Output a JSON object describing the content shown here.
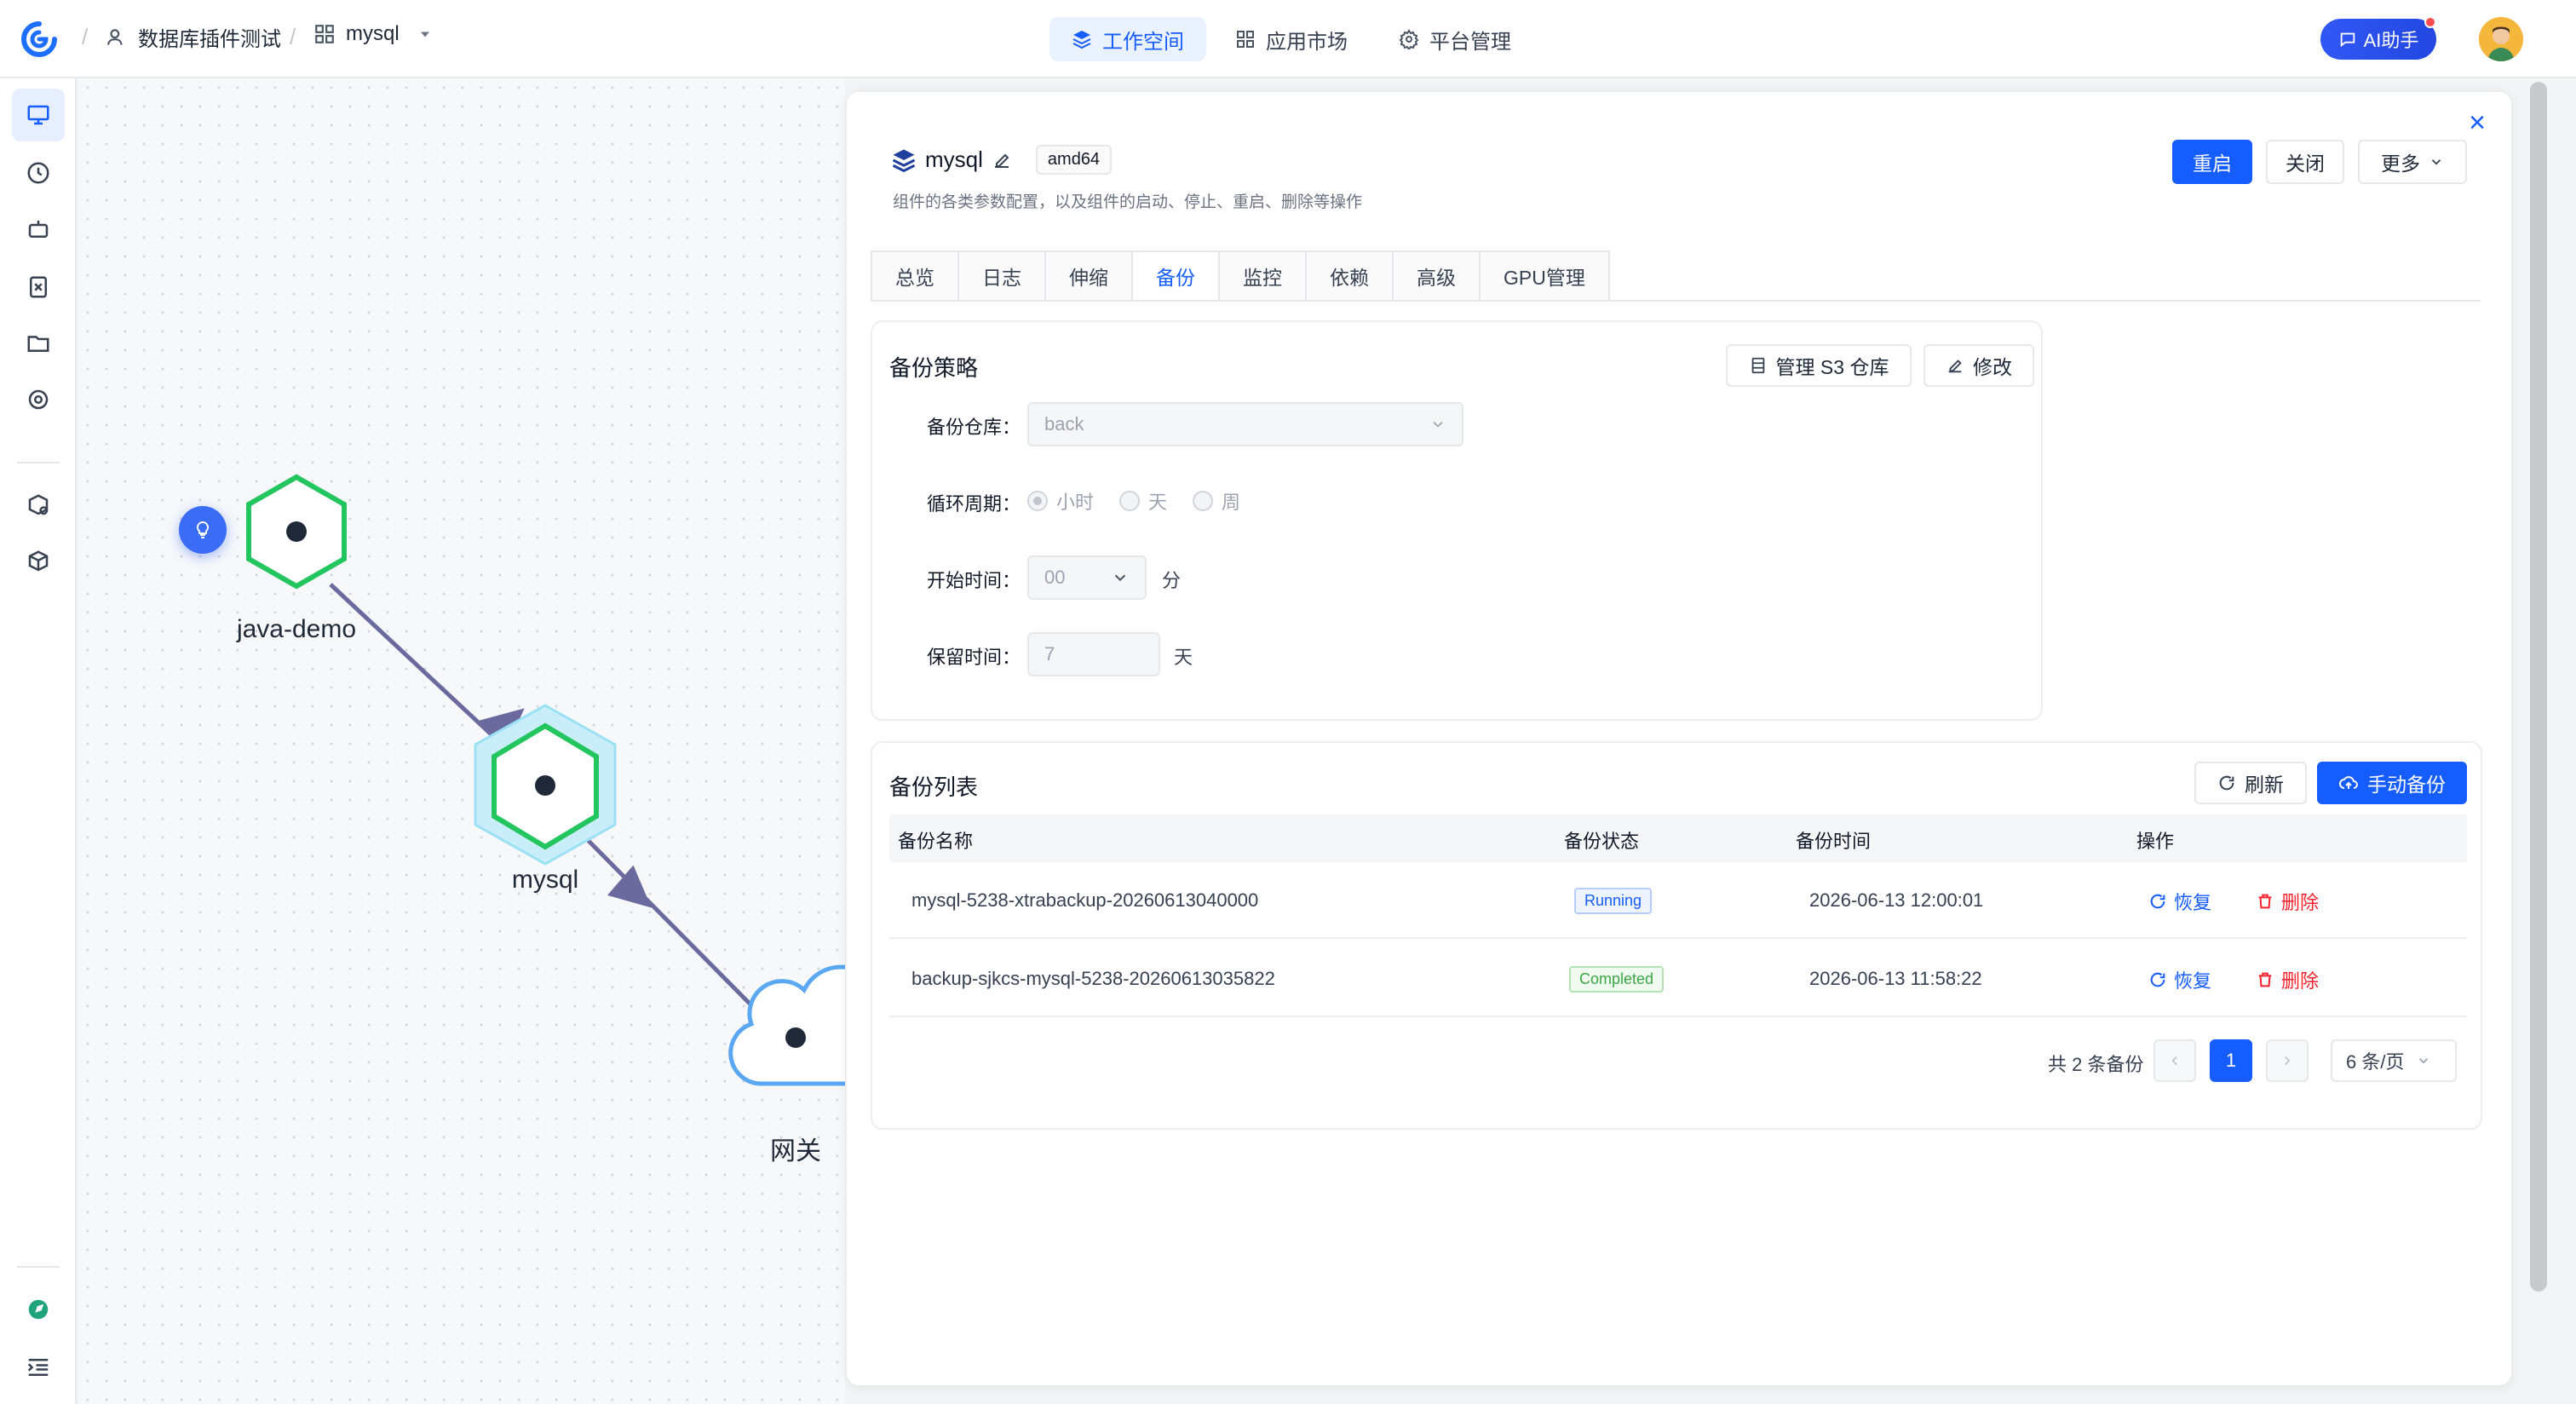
{
  "header": {
    "breadcrumb_team": "数据库插件测试",
    "breadcrumb_app": "mysql",
    "nav": [
      {
        "label": "工作空间",
        "icon": "layers-icon",
        "active": true
      },
      {
        "label": "应用市场",
        "icon": "grid-icon",
        "active": false
      },
      {
        "label": "平台管理",
        "icon": "gear-icon",
        "active": false
      }
    ],
    "ai_label": "AI助手"
  },
  "topology": {
    "nodes": [
      {
        "label": "java-demo"
      },
      {
        "label": "mysql"
      },
      {
        "label": "网关"
      }
    ]
  },
  "panel": {
    "title": "mysql",
    "arch": "amd64",
    "subtitle": "组件的各类参数配置，以及组件的启动、停止、重启、删除等操作",
    "restart_label": "重启",
    "close_label": "关闭",
    "more_label": "更多",
    "tabs": [
      "总览",
      "日志",
      "伸缩",
      "备份",
      "监控",
      "依赖",
      "高级",
      "GPU管理"
    ],
    "active_tab": "备份"
  },
  "policy": {
    "title": "备份策略",
    "manage_s3_label": "管理 S3 仓库",
    "edit_label": "修改",
    "repo_label": "备份仓库：",
    "repo_value": "back",
    "cycle_label": "循环周期：",
    "cycle_options": [
      "小时",
      "天",
      "周"
    ],
    "cycle_selected": "小时",
    "start_label": "开始时间：",
    "start_value": "00",
    "start_unit": "分",
    "retain_label": "保留时间：",
    "retain_value": "7",
    "retain_unit": "天"
  },
  "backup_list": {
    "title": "备份列表",
    "refresh_label": "刷新",
    "manual_label": "手动备份",
    "columns": [
      "备份名称",
      "备份状态",
      "备份时间",
      "操作"
    ],
    "rows": [
      {
        "name": "mysql-5238-xtrabackup-20260613040000",
        "status": "Running",
        "time": "2026-06-13 12:00:01",
        "restore": "恢复",
        "delete": "删除"
      },
      {
        "name": "backup-sjkcs-mysql-5238-20260613035822",
        "status": "Completed",
        "time": "2026-06-13 11:58:22",
        "restore": "恢复",
        "delete": "删除"
      }
    ],
    "total_text": "共 2 条备份",
    "page": "1",
    "page_size": "6 条/页"
  },
  "colors": {
    "primary": "#165dff",
    "node_green": "#22c55e",
    "edge": "#6b6a9e"
  }
}
